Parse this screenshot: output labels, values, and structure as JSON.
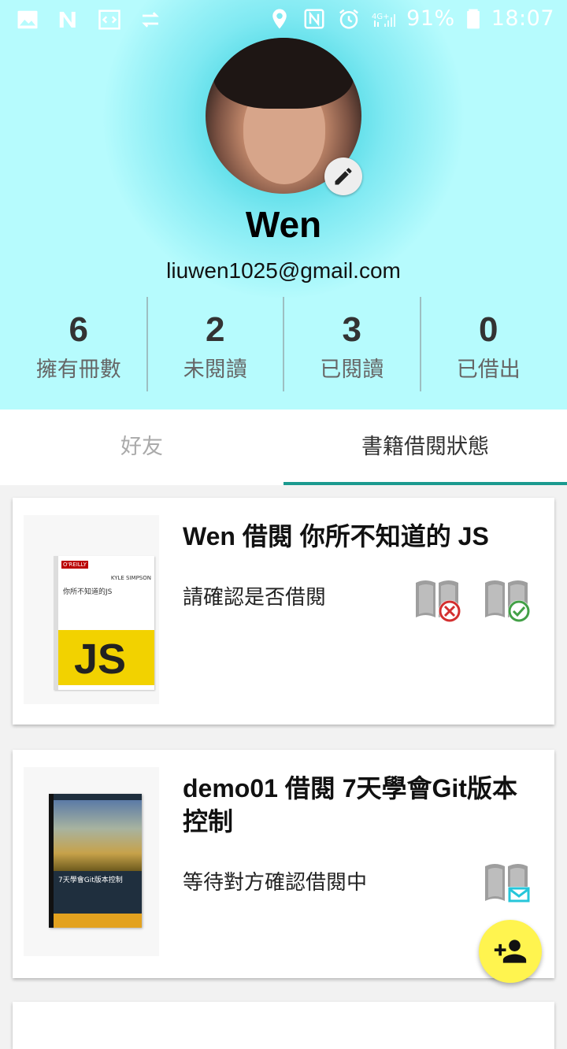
{
  "status_bar": {
    "battery": "91%",
    "time": "18:07"
  },
  "profile": {
    "name": "Wen",
    "email": "liuwen1025@gmail.com"
  },
  "stats": [
    {
      "value": "6",
      "label": "擁有冊數"
    },
    {
      "value": "2",
      "label": "未閱讀"
    },
    {
      "value": "3",
      "label": "已閱讀"
    },
    {
      "value": "0",
      "label": "已借出"
    }
  ],
  "tabs": [
    {
      "label": "好友",
      "active": false
    },
    {
      "label": "書籍借閱狀態",
      "active": true
    }
  ],
  "cards": [
    {
      "title": "Wen 借閱 你所不知道的 JS",
      "status": "請確認是否借閱",
      "cover": {
        "publisher": "O'REILLY",
        "author": "KYLE SIMPSON",
        "title": "你所不知道的JS",
        "logo": "JS"
      }
    },
    {
      "title": "demo01 借閱 7天學會Git版本控制",
      "status": "等待對方確認借閱中",
      "cover": {
        "title": "7天學會Git版本控制"
      }
    }
  ],
  "colors": {
    "header_bg": "#b6fbfd",
    "tab_indicator": "#1b9a8f",
    "fab": "#fff44f",
    "reject": "#d32f2f",
    "accept": "#43a047",
    "mail": "#26c6da"
  }
}
